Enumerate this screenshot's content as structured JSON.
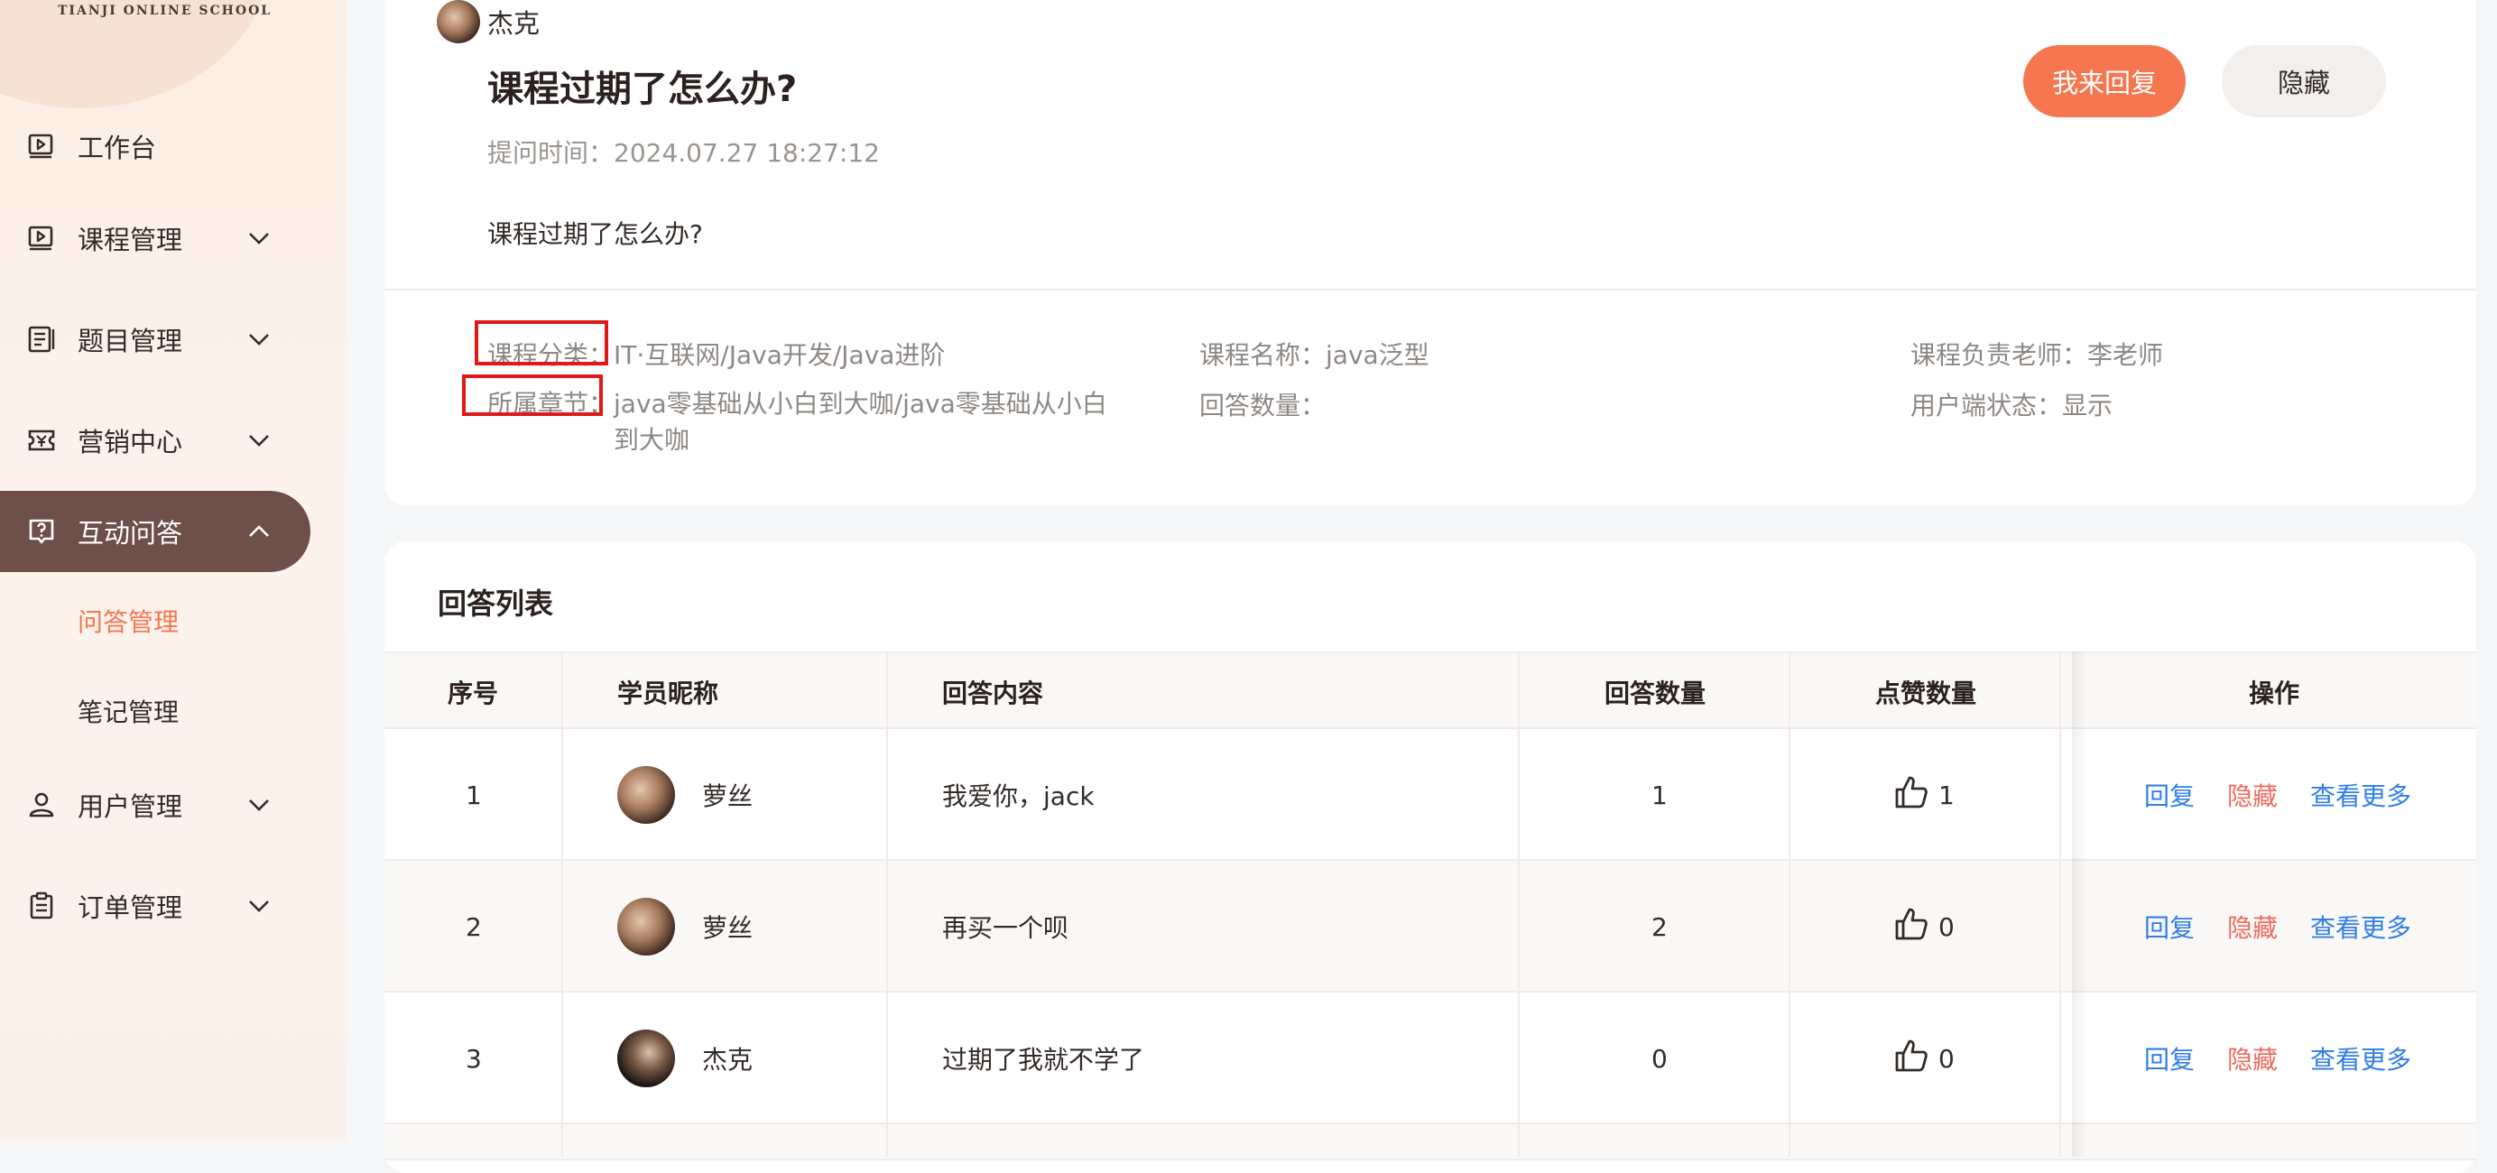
{
  "sidebar": {
    "logo": "TIANJI ONLINE SCHOOL",
    "items": [
      {
        "label": "工作台",
        "icon": "play-square-icon"
      },
      {
        "label": "课程管理",
        "icon": "play-square-icon"
      },
      {
        "label": "题目管理",
        "icon": "list-doc-icon"
      },
      {
        "label": "营销中心",
        "icon": "coupon-icon"
      },
      {
        "label": "互动问答",
        "icon": "question-icon"
      },
      {
        "label": "用户管理",
        "icon": "user-icon"
      },
      {
        "label": "订单管理",
        "icon": "clipboard-icon"
      }
    ],
    "sub_items": [
      "问答管理",
      "笔记管理"
    ]
  },
  "question": {
    "asker": "杰克",
    "title": "课程过期了怎么办?",
    "time": "提问时间：2024.07.27 18:27:12",
    "body": "课程过期了怎么办?",
    "reply_btn": "我来回复",
    "hide_btn": "隐藏",
    "meta": {
      "category_label": "课程分类：",
      "category_value": "IT·互联网/Java开发/Java进阶",
      "chapter_label": "所属章节：",
      "chapter_value_line1": "java零基础从小白到大咖/java零基础从小白",
      "chapter_value_line2": "到大咖",
      "course_name": "课程名称：java泛型",
      "answer_count": "回答数量：",
      "teacher": "课程负责老师：李老师",
      "user_status": "用户端状态：显示"
    }
  },
  "answers": {
    "title": "回答列表",
    "columns": [
      "序号",
      "学员昵称",
      "回答内容",
      "回答数量",
      "点赞数量",
      "操作"
    ],
    "rows": [
      {
        "no": "1",
        "name": "萝丝",
        "content": "我爱你，jack",
        "answers": "1",
        "likes": "1"
      },
      {
        "no": "2",
        "name": "萝丝",
        "content": "再买一个呗",
        "answers": "2",
        "likes": "0"
      },
      {
        "no": "3",
        "name": "杰克",
        "content": "过期了我就不学了",
        "answers": "0",
        "likes": "0"
      }
    ],
    "actions": {
      "reply": "回复",
      "hide": "隐藏",
      "more": "查看更多"
    }
  },
  "colors": {
    "accent": "#f5764f",
    "active_nav": "#6e4f49",
    "link": "#2f7ee8",
    "danger_link": "#f06a5e"
  }
}
